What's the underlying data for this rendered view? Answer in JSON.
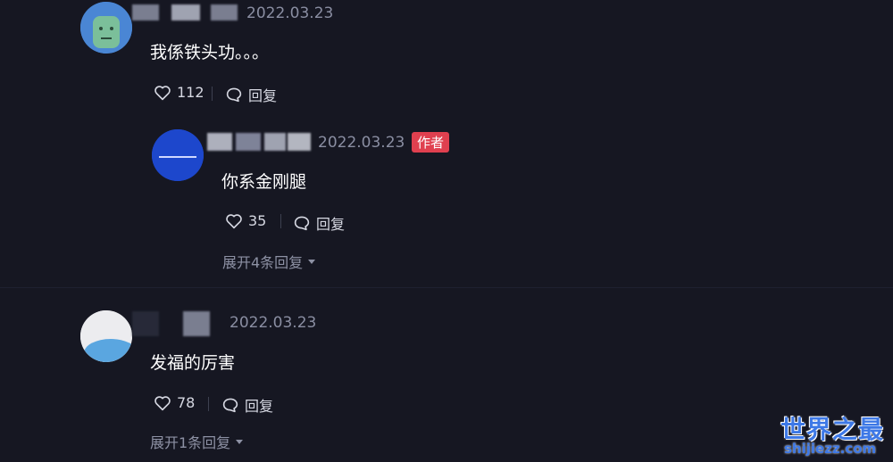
{
  "comments": [
    {
      "date": "2022.03.23",
      "text": "我係铁头功。。。",
      "likes": "112",
      "reply_label": "回复",
      "reply": {
        "date": "2022.03.23",
        "badge": "作者",
        "text": "你系金刚腿",
        "likes": "35",
        "reply_label": "回复",
        "expand": "展开4条回复"
      }
    },
    {
      "date": "2022.03.23",
      "text": "发福的厉害",
      "likes": "78",
      "reply_label": "回复",
      "expand": "展开1条回复"
    }
  ],
  "watermark": {
    "title": "世界之最",
    "url": "shijiezz.com"
  },
  "colors": {
    "background": "#161722",
    "badge": "#e0404f",
    "watermark": "#3d78e6"
  }
}
